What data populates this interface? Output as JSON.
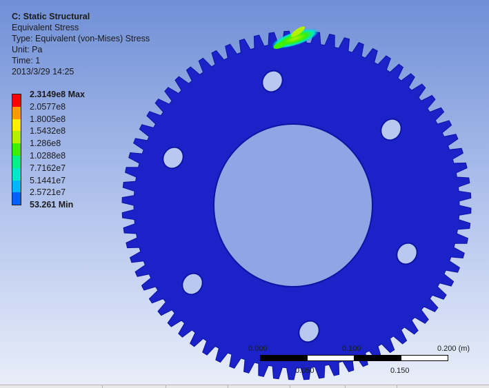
{
  "info": {
    "title": "C: Static Structural",
    "result": "Equivalent Stress",
    "type": "Type: Equivalent (von-Mises) Stress",
    "unit": "Unit: Pa",
    "time": "Time: 1",
    "date": "2013/3/29 14:25"
  },
  "legend": {
    "labels": [
      "2.3149e8 Max",
      "2.0577e8",
      "1.8005e8",
      "1.5432e8",
      "1.286e8",
      "1.0288e8",
      "7.7162e7",
      "5.1441e7",
      "2.5721e7",
      "53.261 Min"
    ],
    "colors": [
      "#ff0000",
      "#ff9a00",
      "#ffee00",
      "#b5f000",
      "#3cf000",
      "#00f08a",
      "#00e8c9",
      "#00b7ff",
      "#0060ff",
      "#0000d8"
    ]
  },
  "scale": {
    "top_labels": [
      "0.000",
      "0.100",
      "0.200 (m)"
    ],
    "bottom_labels": [
      "0.050",
      "0.150"
    ]
  },
  "colors": {
    "model": "#1a22c8",
    "model_dark": "#0d14a4",
    "background_top": "#6f8fd6",
    "background_bottom": "#e9eef9"
  }
}
